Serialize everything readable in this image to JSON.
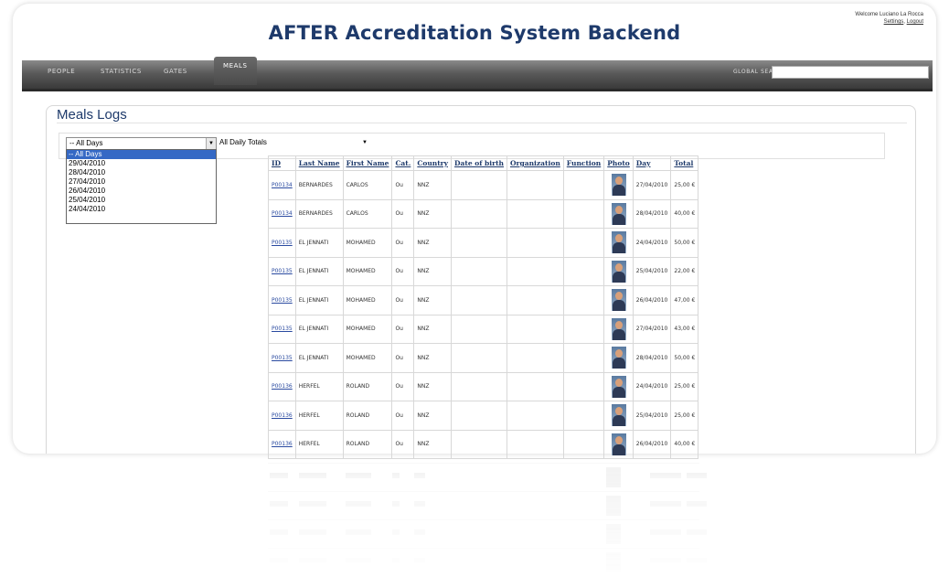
{
  "header": {
    "welcome": "Welcome Luciano La Rocca",
    "settings_link": "Settings",
    "logout_link": "Logout",
    "title": "AFTER Accreditation System Backend"
  },
  "nav": {
    "items": [
      "PEOPLE",
      "STATISTICS",
      "GATES",
      "MEALS"
    ],
    "active": "MEALS",
    "global_search_label": "GLOBAL SEARCH",
    "global_search_value": ""
  },
  "page": {
    "title": "Meals Logs"
  },
  "filters": {
    "day_select_value": "-- All Days",
    "day_options": [
      "-- All Days",
      "29/04/2010",
      "28/04/2010",
      "27/04/2010",
      "26/04/2010",
      "25/04/2010",
      "24/04/2010"
    ],
    "highlighted_option": "-- All Days",
    "totals_select_value": "All Daily Totals"
  },
  "table": {
    "columns": [
      "ID",
      "Last Name",
      "First Name",
      "Cat.",
      "Country",
      "Date of birth",
      "Organization",
      "Function",
      "Photo",
      "Day",
      "Total"
    ],
    "rows": [
      {
        "id": "P00134",
        "last": "BERNARDES",
        "first": "CARLOS",
        "cat": "Ou",
        "country": "NNZ",
        "dob": "",
        "org": "",
        "func": "",
        "day": "27/04/2010",
        "total": "25,00 €"
      },
      {
        "id": "P00134",
        "last": "BERNARDES",
        "first": "CARLOS",
        "cat": "Ou",
        "country": "NNZ",
        "dob": "",
        "org": "",
        "func": "",
        "day": "28/04/2010",
        "total": "40,00 €"
      },
      {
        "id": "P00135",
        "last": "EL JENNATI",
        "first": "MOHAMED",
        "cat": "Ou",
        "country": "NNZ",
        "dob": "",
        "org": "",
        "func": "",
        "day": "24/04/2010",
        "total": "50,00 €"
      },
      {
        "id": "P00135",
        "last": "EL JENNATI",
        "first": "MOHAMED",
        "cat": "Ou",
        "country": "NNZ",
        "dob": "",
        "org": "",
        "func": "",
        "day": "25/04/2010",
        "total": "22,00 €"
      },
      {
        "id": "P00135",
        "last": "EL JENNATI",
        "first": "MOHAMED",
        "cat": "Ou",
        "country": "NNZ",
        "dob": "",
        "org": "",
        "func": "",
        "day": "26/04/2010",
        "total": "47,00 €"
      },
      {
        "id": "P00135",
        "last": "EL JENNATI",
        "first": "MOHAMED",
        "cat": "Ou",
        "country": "NNZ",
        "dob": "",
        "org": "",
        "func": "",
        "day": "27/04/2010",
        "total": "43,00 €"
      },
      {
        "id": "P00135",
        "last": "EL JENNATI",
        "first": "MOHAMED",
        "cat": "Ou",
        "country": "NNZ",
        "dob": "",
        "org": "",
        "func": "",
        "day": "28/04/2010",
        "total": "50,00 €"
      },
      {
        "id": "P00136",
        "last": "HERFEL",
        "first": "ROLAND",
        "cat": "Ou",
        "country": "NNZ",
        "dob": "",
        "org": "",
        "func": "",
        "day": "24/04/2010",
        "total": "25,00 €"
      },
      {
        "id": "P00136",
        "last": "HERFEL",
        "first": "ROLAND",
        "cat": "Ou",
        "country": "NNZ",
        "dob": "",
        "org": "",
        "func": "",
        "day": "25/04/2010",
        "total": "25,00 €"
      },
      {
        "id": "P00136",
        "last": "HERFEL",
        "first": "ROLAND",
        "cat": "Ou",
        "country": "NNZ",
        "dob": "",
        "org": "",
        "func": "",
        "day": "26/04/2010",
        "total": "40,00 €"
      }
    ]
  },
  "colors": {
    "title_blue": "#1e3a6b",
    "nav_dark": "#3a3a3a",
    "link_blue": "#2a4aa0",
    "highlight": "#3569c5"
  }
}
